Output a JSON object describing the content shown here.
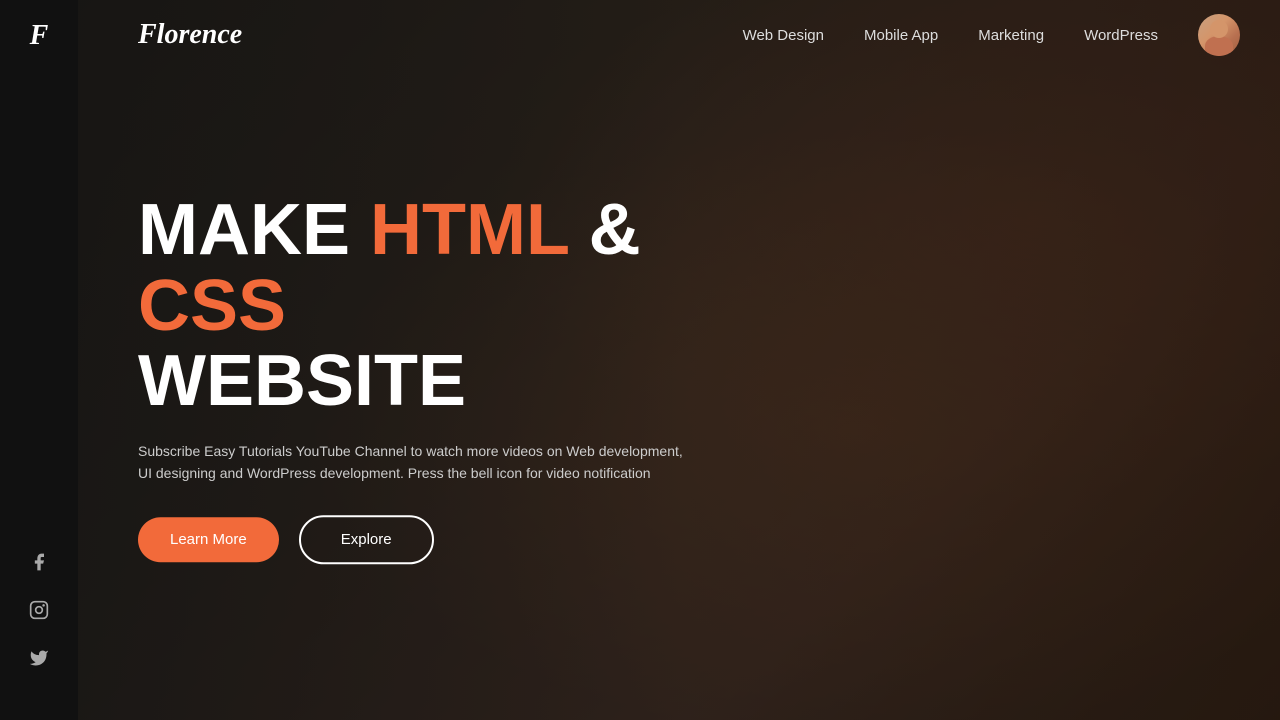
{
  "sidebar": {
    "logo_letter": "F",
    "social": [
      {
        "name": "facebook",
        "symbol": "f"
      },
      {
        "name": "instagram",
        "symbol": "ig"
      },
      {
        "name": "twitter",
        "symbol": "tw"
      }
    ]
  },
  "navbar": {
    "brand": "Florence",
    "links": [
      {
        "label": "Web Design",
        "id": "web-design"
      },
      {
        "label": "Mobile App",
        "id": "mobile-app"
      },
      {
        "label": "Marketing",
        "id": "marketing"
      },
      {
        "label": "WordPress",
        "id": "wordpress"
      }
    ]
  },
  "hero": {
    "title_line1_white": "MAKE ",
    "title_line1_orange1": "HTML",
    "title_line1_and": " & ",
    "title_line1_orange2": "CSS",
    "title_line2": "WEBSITE",
    "description": "Subscribe Easy Tutorials YouTube Channel to watch more videos on Web development, UI designing and WordPress development. Press the bell icon for video notification",
    "btn_learn_more": "Learn More",
    "btn_explore": "Explore"
  },
  "colors": {
    "accent": "#f26a3a",
    "sidebar_bg": "#111111",
    "text_white": "#ffffff",
    "text_muted": "#cccccc"
  }
}
